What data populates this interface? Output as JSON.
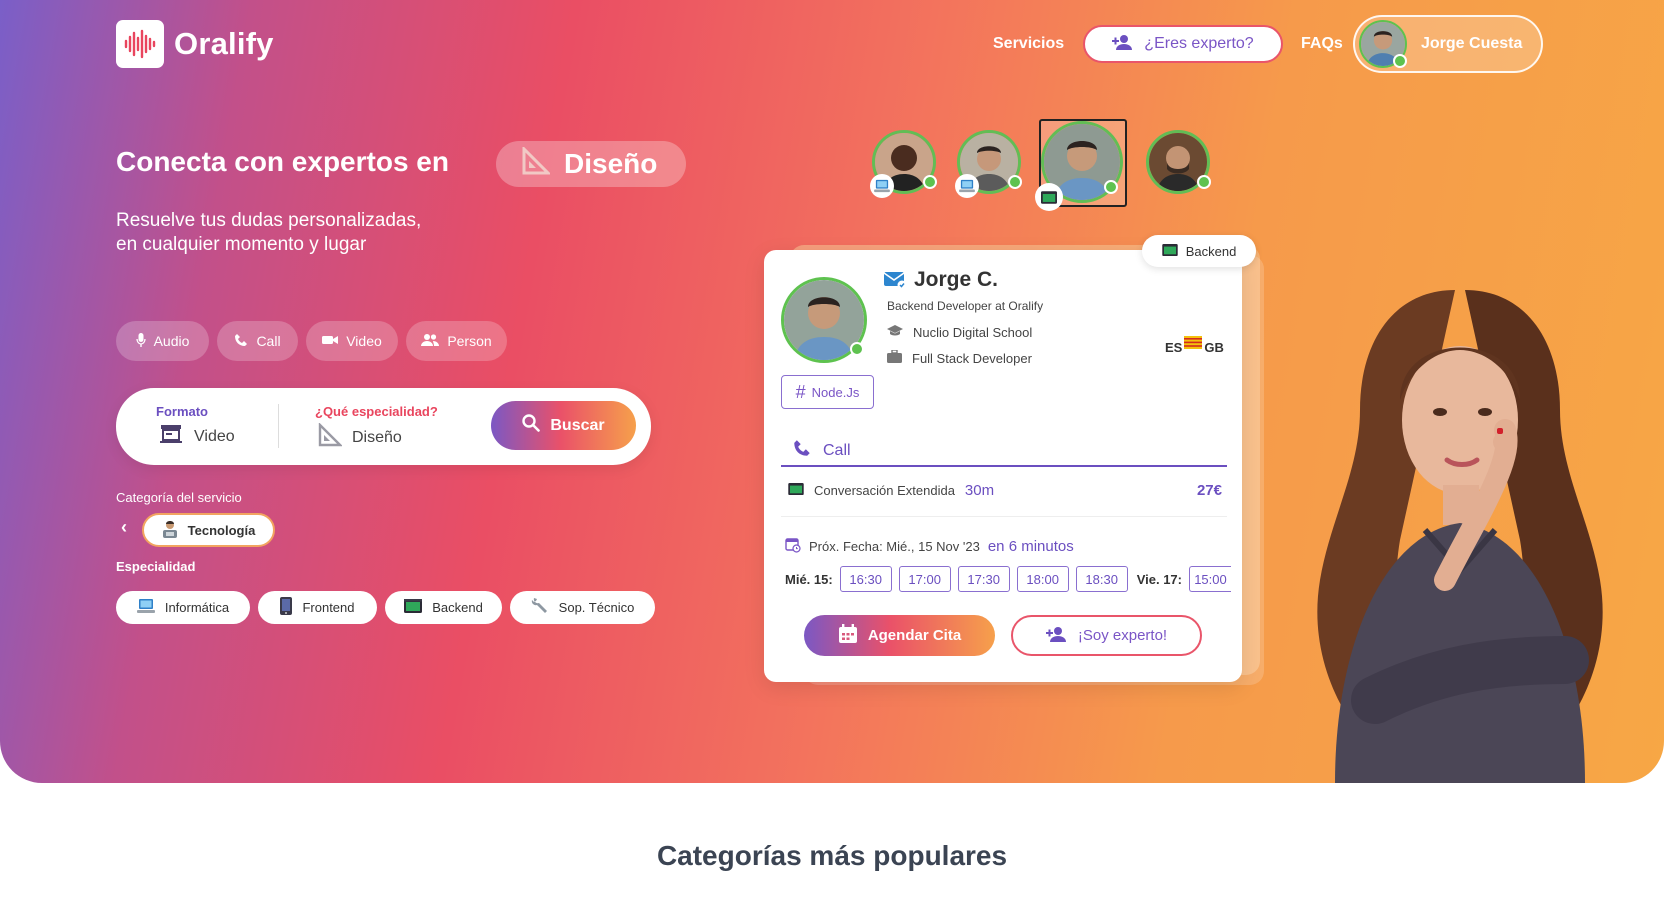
{
  "brand": {
    "name": "Oralify"
  },
  "nav": {
    "services": "Servicios",
    "expert_cta": "¿Eres experto?",
    "faqs": "FAQs",
    "user_name": "Jorge Cuesta"
  },
  "hero": {
    "headline": "Conecta con expertos en",
    "topic": "Diseño",
    "sub_line1": "Resuelve tus dudas personalizadas,",
    "sub_line2": "en cualquier momento y lugar"
  },
  "formats": [
    {
      "label": "Audio",
      "icon": "mic-icon"
    },
    {
      "label": "Call",
      "icon": "phone-icon"
    },
    {
      "label": "Video",
      "icon": "video-icon"
    },
    {
      "label": "Person",
      "icon": "people-icon"
    }
  ],
  "search": {
    "format_label": "Formato",
    "format_value": "Video",
    "specialty_label": "¿Qué especialidad?",
    "specialty_value": "Diseño",
    "button": "Buscar"
  },
  "category": {
    "label": "Categoría del servicio",
    "selected": "Tecnología",
    "specialty_label": "Especialidad",
    "specialties": [
      "Informática",
      "Frontend",
      "Backend",
      "Sop. Técnico"
    ]
  },
  "expert": {
    "badge": "Backend",
    "name": "Jorge C.",
    "role": "Backend Developer at Oralify",
    "school": "Nuclio Digital School",
    "job": "Full Stack Developer",
    "lang_es": "ES",
    "lang_gb": "GB",
    "skill": "Node.Js",
    "tab": "Call",
    "service_name": "Conversación Extendida",
    "service_duration": "30m",
    "service_price": "27€",
    "next_label": "Próx. Fecha: Mié., 15 Nov '23",
    "next_relative": "en 6 minutos",
    "day1": "Mié. 15:",
    "day1_slots": [
      "16:30",
      "17:00",
      "17:30",
      "18:00",
      "18:30"
    ],
    "day2": "Vie. 17:",
    "day2_slots": [
      "15:00"
    ],
    "book_button": "Agendar Cita",
    "expert_button": "¡Soy experto!"
  },
  "popular": {
    "title": "Categorías más populares"
  },
  "colors": {
    "accent_purple": "#6b4fc0",
    "accent_red": "#e9556a",
    "online_green": "#5ec24f"
  }
}
